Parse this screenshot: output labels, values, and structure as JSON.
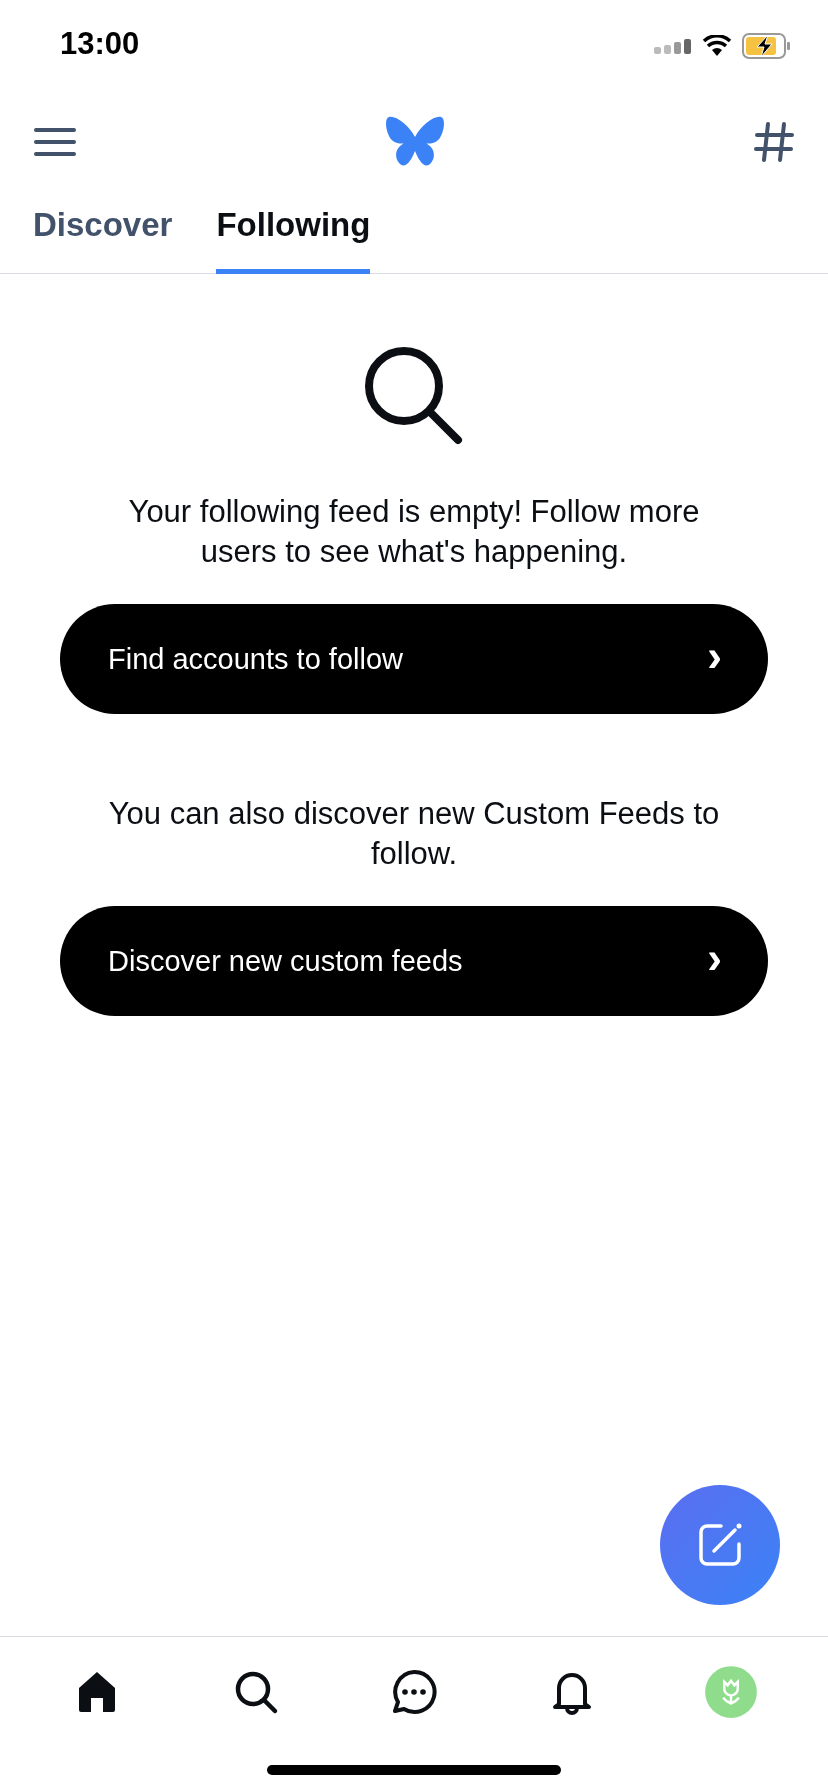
{
  "status_bar": {
    "time": "13:00"
  },
  "tabs": [
    {
      "label": "Discover",
      "selected": false
    },
    {
      "label": "Following",
      "selected": true
    }
  ],
  "empty_state": {
    "message": "Your following feed is empty! Follow more users to see what's happening.",
    "buttons": [
      {
        "label": "Find accounts to follow",
        "chevron": "›"
      }
    ],
    "secondary_message": "You can also discover new Custom Feeds to follow.",
    "secondary_buttons": [
      {
        "label": "Discover new custom feeds",
        "chevron": "›"
      }
    ]
  },
  "bottom_nav": [
    {
      "kind": "home"
    },
    {
      "kind": "search"
    },
    {
      "kind": "chat"
    },
    {
      "kind": "bell"
    },
    {
      "kind": "avatar"
    }
  ]
}
